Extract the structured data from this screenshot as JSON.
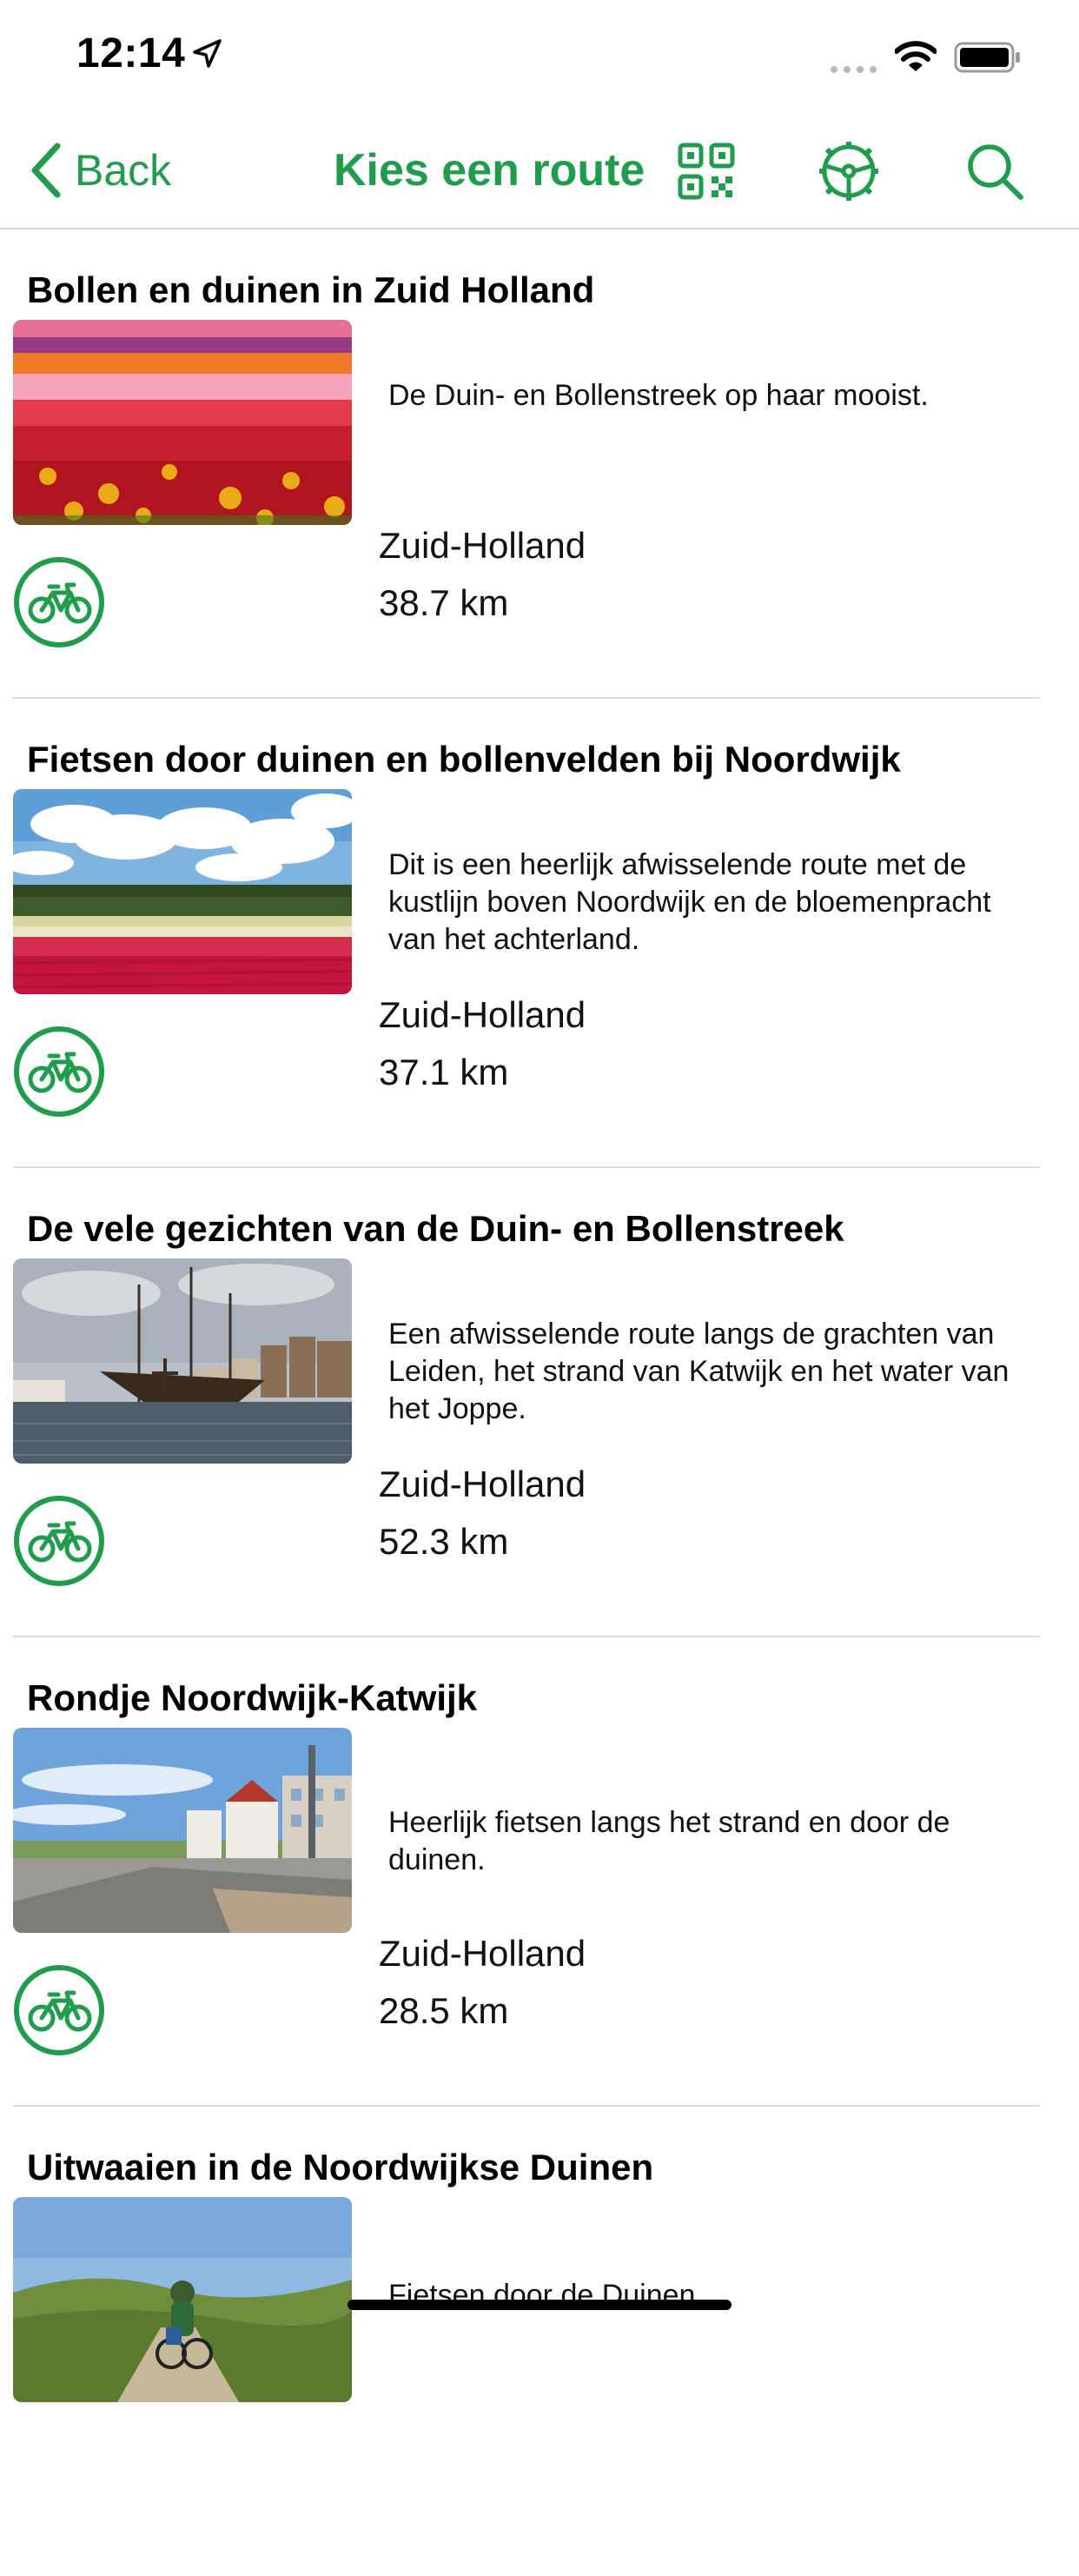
{
  "status_bar": {
    "time": "12:14",
    "icons": [
      "location-arrow-icon",
      "signal-icon",
      "wifi-icon",
      "battery-icon"
    ]
  },
  "nav": {
    "back_label": "Back",
    "title": "Kies een route",
    "icons": [
      "qr-code-icon",
      "steering-wheel-icon",
      "search-icon"
    ]
  },
  "colors": {
    "accent": "#1f9d4c",
    "divider": "#dcdcdc"
  },
  "routes": [
    {
      "title": "Bollen en duinen in Zuid Holland",
      "description": "De Duin- en Bollenstreek op haar mooist.",
      "region": "Zuid-Holland",
      "distance": "38.7 km",
      "type_icon": "bicycle-icon"
    },
    {
      "title": "Fietsen door duinen en bollenvelden bij Noordwijk",
      "description": "Dit is een heerlijk afwisselende route met de kustlijn boven Noordwijk en de bloemenpracht van het achterland.",
      "region": "Zuid-Holland",
      "distance": "37.1 km",
      "type_icon": "bicycle-icon"
    },
    {
      "title": "De vele gezichten van de Duin- en Bollenstreek",
      "description": "Een afwisselende route langs de grachten van Leiden, het strand van Katwijk en het water van het Joppe.",
      "region": "Zuid-Holland",
      "distance": "52.3 km",
      "type_icon": "bicycle-icon"
    },
    {
      "title": "Rondje Noordwijk-Katwijk",
      "description": "Heerlijk fietsen langs het strand en door de duinen.",
      "region": "Zuid-Holland",
      "distance": "28.5 km",
      "type_icon": "bicycle-icon"
    },
    {
      "title": "Uitwaaien in de Noordwijkse Duinen",
      "description": "Fietsen door de Duinen"
    }
  ]
}
